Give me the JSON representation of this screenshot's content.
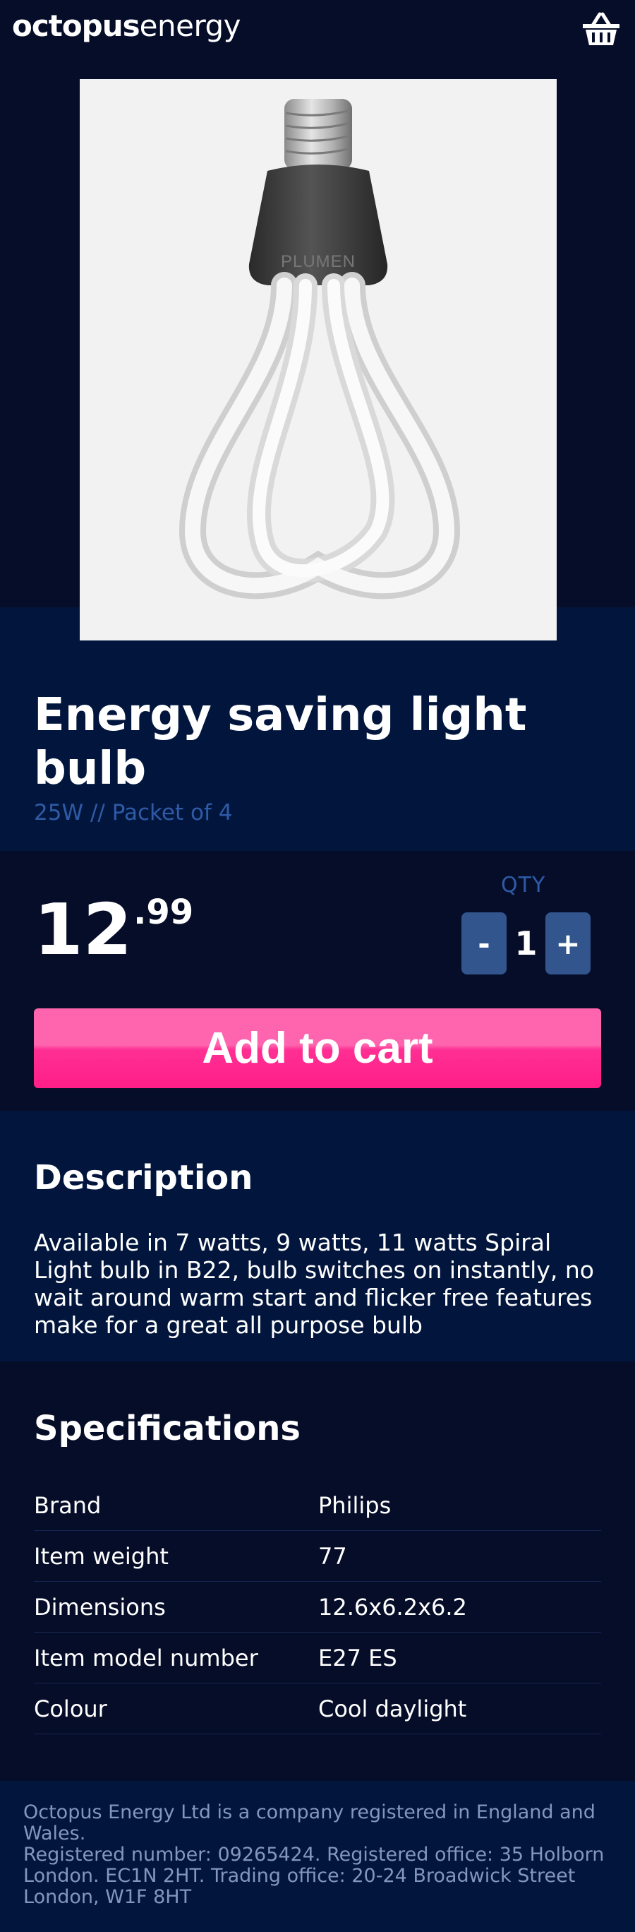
{
  "header": {
    "logo_bold": "octopus",
    "logo_light": "energy",
    "basket_icon": "basket-icon"
  },
  "product": {
    "image_icon": "light-bulb-image",
    "image_brand_text": "PLUMEN",
    "title": "Energy saving light bulb",
    "subtitle": "25W // Packet of 4",
    "price_main": "12",
    "price_cents": ".99",
    "qty_label": "QTY",
    "qty_minus": "-",
    "qty_value": "1",
    "qty_plus": "+",
    "add_to_cart": "Add to cart"
  },
  "description": {
    "heading": "Description",
    "text": "Available in 7 watts, 9 watts, 11 watts Spiral Light bulb in B22, bulb switches on instantly, no wait around warm start and flicker free features make for a great all purpose bulb"
  },
  "specifications": {
    "heading": "Specifications",
    "rows": [
      {
        "key": "Brand",
        "value": "Philips"
      },
      {
        "key": "Item weight",
        "value": "77"
      },
      {
        "key": "Dimensions",
        "value": "12.6x6.2x6.2"
      },
      {
        "key": "Item model number",
        "value": "E27 ES"
      },
      {
        "key": "Colour",
        "value": "Cool daylight"
      }
    ]
  },
  "footer": {
    "line1": "Octopus Energy Ltd is a company registered in England and Wales.",
    "line2": "Registered number: 09265424. Registered office: 35 Holborn London. EC1N 2HT. Trading office: 20-24 Broadwick Street London, W1F 8HT"
  },
  "colors": {
    "background_dark": "#060d29",
    "background_navy": "#02163d",
    "accent_pink": "#ff1e88",
    "muted_blue": "#2e5aa6",
    "qty_button": "#32558e"
  }
}
